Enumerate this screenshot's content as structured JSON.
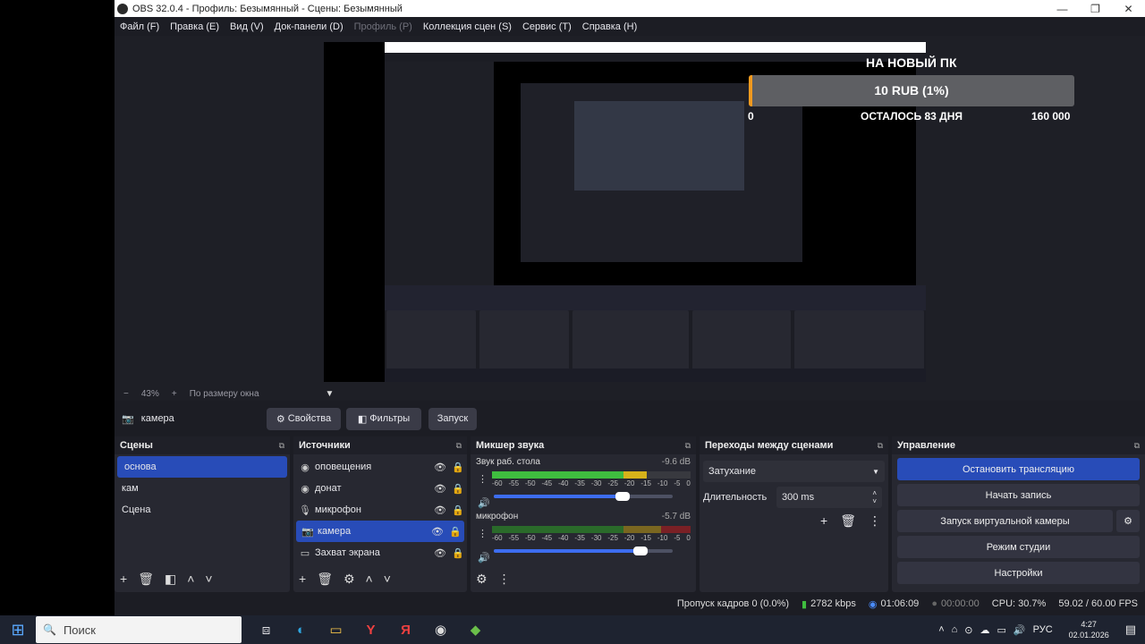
{
  "window": {
    "title": "OBS 32.0.4 - Профиль: Безымянный - Сцены: Безымянный",
    "min_glyph": "—",
    "max_glyph": "❐",
    "close_glyph": "✕"
  },
  "menu": [
    "Файл (F)",
    "Правка (E)",
    "Вид (V)",
    "Док-панели (D)",
    "Профиль (P)",
    "Коллекция сцен (S)",
    "Сервис (T)",
    "Справка (H)"
  ],
  "overlay": {
    "title": "НА НОВЫЙ ПК",
    "amount": "10 RUB (1%)",
    "min": "0",
    "remaining": "ОСТАЛОСЬ 83 ДНЯ",
    "max": "160 000",
    "progress": 0.01,
    "fill_color": "#f29a1f"
  },
  "zoom": {
    "minus": "−",
    "level": "43%",
    "plus": "+",
    "fit": "По размеру окна",
    "dropdown_glyph": "▼"
  },
  "source_bar": {
    "icon": "camera-icon",
    "icon_glyph": "📷",
    "name": "камера",
    "properties": "Свойства",
    "properties_glyph": "⚙",
    "filters": "Фильтры",
    "filters_glyph": "◧",
    "activate": "Запуск"
  },
  "scenes": {
    "title": "Сцены",
    "undock_glyph": "⧉",
    "items": [
      "основа",
      "кам",
      "Сцена"
    ],
    "selected": 0,
    "footer": [
      "+",
      "🗑",
      "◧",
      "˄",
      "˅"
    ]
  },
  "sources": {
    "title": "Источники",
    "undock_glyph": "⧉",
    "items": [
      {
        "label": "оповещения",
        "icon": "browser-icon",
        "glyph": "◉"
      },
      {
        "label": "донат",
        "icon": "browser-icon",
        "glyph": "◉"
      },
      {
        "label": "микрофон",
        "icon": "microphone-icon",
        "glyph": "🎙"
      },
      {
        "label": "камера",
        "icon": "camera-icon",
        "glyph": "📷"
      },
      {
        "label": "Захват экрана",
        "icon": "monitor-icon",
        "glyph": "▭"
      }
    ],
    "selected": 3,
    "eye_glyph": "👁",
    "lock_glyph": "🔒",
    "footer": [
      "+",
      "🗑",
      "⚙",
      "˄",
      "˅"
    ]
  },
  "mixer": {
    "title": "Микшер звука",
    "undock_glyph": "⧉",
    "menu_glyph": "⋮",
    "vol_glyph": "🔊",
    "scale": [
      "-60",
      "-55",
      "-50",
      "-45",
      "-40",
      "-35",
      "-30",
      "-25",
      "-20",
      "-15",
      "-10",
      "-5",
      "0"
    ],
    "channels": [
      {
        "name": "Звук раб. стола",
        "db": "-9.6 dB",
        "level": 0.78,
        "volume": 0.72
      },
      {
        "name": "микрофон",
        "db": "-5.7 dB",
        "level": 0.0,
        "volume": 0.82
      }
    ],
    "footer": [
      "⚙",
      "⋮"
    ]
  },
  "transitions": {
    "title": "Переходы между сценами",
    "undock_glyph": "⧉",
    "current": "Затухание",
    "dropdown_glyph": "▼",
    "duration_label": "Длительность",
    "duration": "300 ms",
    "spin_up": "˄",
    "spin_down": "˅",
    "actions": [
      "+",
      "🗑",
      "⋮"
    ]
  },
  "controls": {
    "title": "Управление",
    "undock_glyph": "⧉",
    "stop_stream": "Остановить трансляцию",
    "start_record": "Начать запись",
    "virtual_cam": "Запуск виртуальной камеры",
    "virtual_cam_gear": "⚙",
    "studio_mode": "Режим студии",
    "settings": "Настройки"
  },
  "status": {
    "dropped": "Пропуск кадров 0 (0.0%)",
    "bitrate_glyph": "▮",
    "bitrate": "2782 kbps",
    "stream_glyph": "◉",
    "stream_time": "01:06:09",
    "rec_glyph": "●",
    "rec_time": "00:00:00",
    "cpu": "CPU: 30.7%",
    "fps": "59.02 / 60.00 FPS"
  },
  "taskbar": {
    "start_glyph": "⊞",
    "search_placeholder": "Поиск",
    "search_icon": "search-icon",
    "search_glyph": "🔍",
    "apps": [
      "⧈",
      "◐",
      "▭",
      "Y",
      "Я",
      "◉",
      "◆"
    ],
    "tray_glyphs": [
      "˄",
      "⌂",
      "⊙",
      "☁",
      "▭",
      "🔊"
    ],
    "lang": "РУС",
    "time": "4:27",
    "date": "02.01.2026",
    "notif_glyph": "▤"
  },
  "colors": {
    "accent": "#284cb8",
    "panel": "#272831",
    "background": "#1c1d24"
  }
}
